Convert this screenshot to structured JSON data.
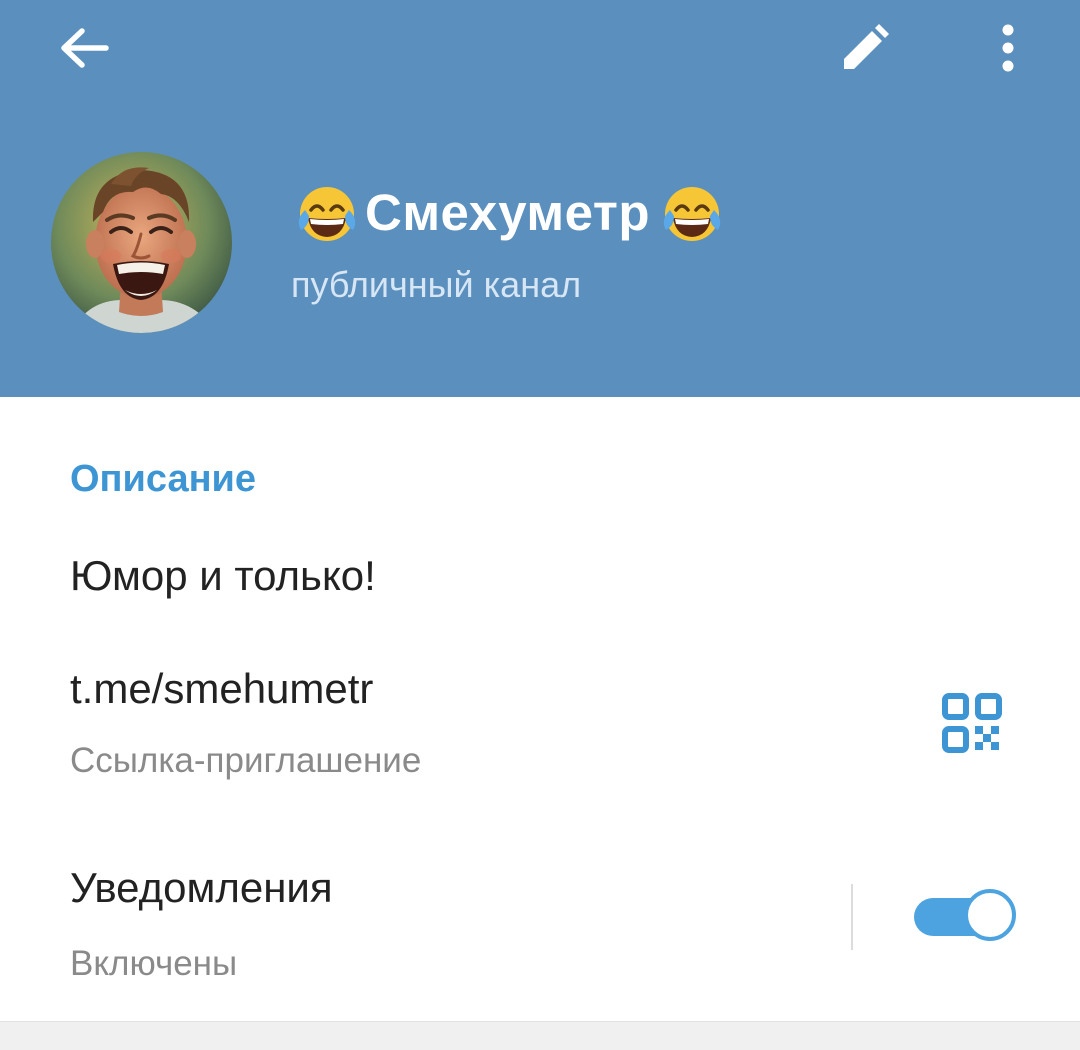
{
  "header": {
    "title": "Смехуметр",
    "title_prefix_emoji": "face-with-tears-of-joy-icon",
    "title_suffix_emoji": "face-with-tears-of-joy-icon",
    "subtitle": "публичный канал",
    "background_color": "#5b8fbd",
    "back_icon": "arrow-left-icon",
    "edit_icon": "pencil-icon",
    "more_icon": "more-vertical-icon"
  },
  "info": {
    "section_title": "Описание",
    "description": "Юмор и только!",
    "link": {
      "value": "t.me/smehumetr",
      "caption": "Ссылка-приглашение",
      "qr_icon": "qr-code-icon"
    },
    "notifications": {
      "label": "Уведомления",
      "status": "Включены",
      "enabled": true
    },
    "accent_color": "#3d95d4"
  }
}
